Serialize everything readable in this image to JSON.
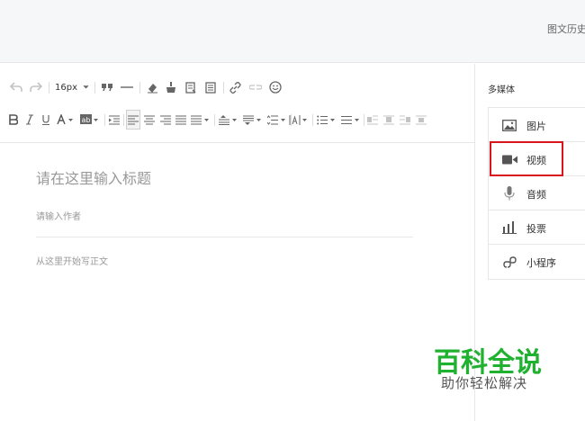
{
  "header": {
    "history_label": "图文历史"
  },
  "toolbar": {
    "font_size": "16px"
  },
  "editor": {
    "title_placeholder": "请在这里输入标题",
    "author_placeholder": "请输入作者",
    "body_placeholder": "从这里开始写正文"
  },
  "sidebar": {
    "heading": "多媒体",
    "items": [
      {
        "label": "图片",
        "icon": "image-icon"
      },
      {
        "label": "视频",
        "icon": "video-icon"
      },
      {
        "label": "音频",
        "icon": "microphone-icon"
      },
      {
        "label": "投票",
        "icon": "vote-chart-icon"
      },
      {
        "label": "小程序",
        "icon": "mini-program-icon"
      }
    ]
  },
  "watermark": {
    "title": "百科全说",
    "subtitle": "助你轻松解决",
    "color": "#1fb12f"
  },
  "colors": {
    "highlight": "#d9141c",
    "topbar": "#f6f7f9",
    "border": "#e7e7eb"
  }
}
